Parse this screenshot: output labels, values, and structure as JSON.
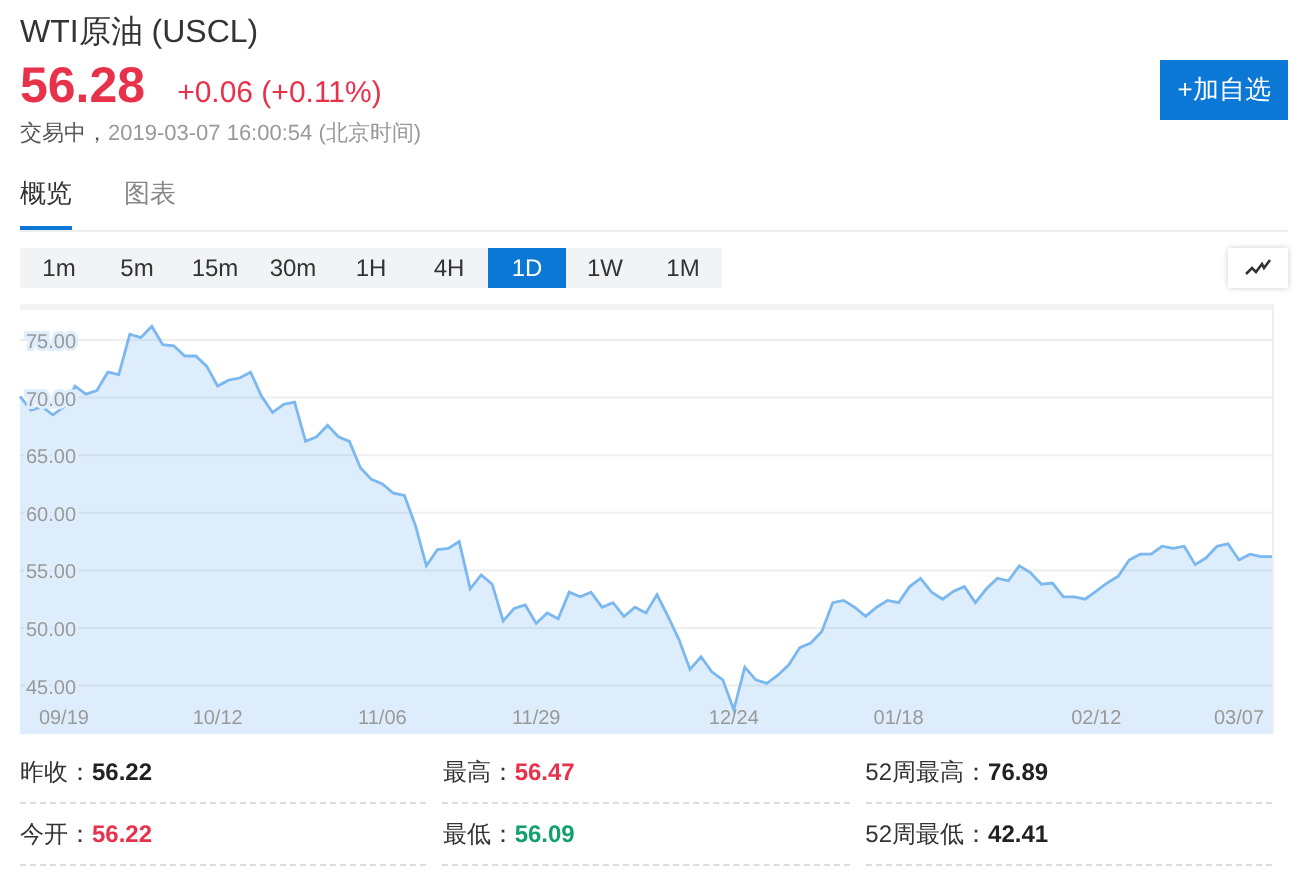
{
  "header": {
    "title": "WTI原油 (USCL)",
    "price": "56.28",
    "change": "+0.06 (+0.11%)",
    "color": "#e8314b",
    "status": "交易中，",
    "timestamp": "2019-03-07 16:00:54",
    "timezone": "(北京时间)",
    "watch_button": "+加自选"
  },
  "tabs": [
    {
      "label": "概览",
      "selected": true
    },
    {
      "label": "图表",
      "selected": false
    }
  ],
  "intervals": [
    {
      "label": "1m",
      "selected": false
    },
    {
      "label": "5m",
      "selected": false
    },
    {
      "label": "15m",
      "selected": false
    },
    {
      "label": "30m",
      "selected": false
    },
    {
      "label": "1H",
      "selected": false
    },
    {
      "label": "4H",
      "selected": false
    },
    {
      "label": "1D",
      "selected": true
    },
    {
      "label": "1W",
      "selected": false
    },
    {
      "label": "1M",
      "selected": false
    }
  ],
  "chart": {
    "chart_data": {
      "type": "area",
      "categories": [
        null,
        null,
        null,
        null,
        "09/19",
        null,
        null,
        null,
        null,
        null,
        null,
        null,
        null,
        null,
        null,
        null,
        null,
        null,
        "10/12",
        null,
        null,
        null,
        null,
        null,
        null,
        null,
        null,
        null,
        null,
        null,
        null,
        null,
        null,
        "11/06",
        null,
        null,
        null,
        null,
        null,
        null,
        null,
        null,
        null,
        null,
        null,
        null,
        null,
        "11/29",
        null,
        null,
        null,
        null,
        null,
        null,
        null,
        null,
        null,
        null,
        null,
        null,
        null,
        null,
        null,
        null,
        null,
        "12/24",
        null,
        null,
        null,
        null,
        null,
        null,
        null,
        null,
        null,
        null,
        null,
        null,
        null,
        null,
        "01/18",
        null,
        null,
        null,
        null,
        null,
        null,
        null,
        null,
        null,
        null,
        null,
        null,
        null,
        null,
        null,
        null,
        null,
        "02/12",
        null,
        null,
        null,
        null,
        null,
        null,
        null,
        null,
        null,
        null,
        null,
        null,
        "03/07",
        null,
        null,
        null
      ],
      "series": [
        {
          "color": "#7ab8ef",
          "values": [
            70.1,
            68.9,
            69.2,
            68.5,
            69.2,
            71.0,
            70.3,
            70.6,
            72.2,
            72.0,
            75.5,
            75.2,
            76.2,
            74.6,
            74.5,
            73.6,
            73.6,
            72.7,
            71.0,
            71.5,
            71.7,
            72.2,
            70.1,
            68.7,
            69.4,
            69.6,
            66.2,
            66.6,
            67.6,
            66.6,
            66.2,
            63.9,
            62.9,
            62.5,
            61.7,
            61.5,
            58.9,
            55.4,
            56.8,
            56.9,
            57.5,
            53.4,
            54.6,
            53.8,
            50.6,
            51.7,
            52.0,
            50.4,
            51.3,
            50.8,
            53.1,
            52.7,
            53.1,
            51.8,
            52.2,
            51.0,
            51.8,
            51.3,
            52.9,
            51.0,
            49.0,
            46.4,
            47.5,
            46.2,
            45.5,
            42.9,
            46.6,
            45.5,
            45.2,
            45.9,
            46.8,
            48.3,
            48.7,
            49.7,
            52.2,
            52.4,
            51.8,
            51.0,
            51.8,
            52.4,
            52.2,
            53.6,
            54.3,
            53.1,
            52.5,
            53.2,
            53.6,
            52.2,
            53.4,
            54.3,
            54.1,
            55.4,
            54.8,
            53.8,
            53.9,
            52.7,
            52.7,
            52.5,
            53.2,
            53.9,
            54.5,
            55.9,
            56.4,
            56.4,
            57.1,
            56.9,
            57.1,
            55.5,
            56.1,
            57.1,
            57.3,
            55.9,
            56.4,
            56.2,
            56.2
          ]
        }
      ],
      "ylim": [
        40.8,
        77.6
      ],
      "grid": true,
      "yticks": [
        {
          "value": 45,
          "label": "45.00"
        },
        {
          "value": 50,
          "label": "50.00"
        },
        {
          "value": 55,
          "label": "55.00"
        },
        {
          "value": 60,
          "label": "60.00"
        },
        {
          "value": 65,
          "label": "65.00"
        },
        {
          "value": 70,
          "label": "70.00"
        },
        {
          "value": 75,
          "label": "75.00"
        }
      ]
    }
  },
  "stats": [
    {
      "label": "昨收：",
      "value": "56.22",
      "color": "#222222"
    },
    {
      "label": "最高：",
      "value": "56.47",
      "color": "#e8314b"
    },
    {
      "label": "52周最高：",
      "value": "76.89",
      "color": "#222222"
    },
    {
      "label": "今开：",
      "value": "56.22",
      "color": "#e8314b"
    },
    {
      "label": "最低：",
      "value": "56.09",
      "color": "#12a06b"
    },
    {
      "label": "52周最低：",
      "value": "42.41",
      "color": "#222222"
    }
  ]
}
